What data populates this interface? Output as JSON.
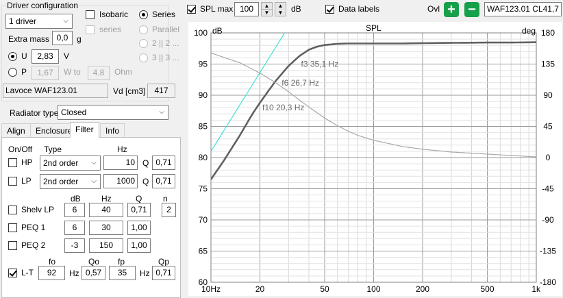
{
  "left": {
    "driver_config_title": "Driver configuration",
    "driver_count": "1 driver",
    "isobaric_label": "Isobaric",
    "series_option": "Series",
    "series_sub_label": "series",
    "parallel_option": "Parallel",
    "option_2_2": "2 || 2 ...",
    "option_3_3": "3 || 3 ...",
    "extra_mass_label": "Extra mass",
    "extra_mass_value": "0,0",
    "extra_mass_unit": "g",
    "u_label": "U",
    "u_value": "2,83",
    "u_unit": "V",
    "p_label": "P",
    "p_value": "1,67",
    "w_to_label": "W to",
    "ohm_value": "4,8",
    "ohm_unit": "Ohm",
    "driver_name": "Lavoce WAF123.01",
    "vd_label": "Vd [cm3]",
    "vd_value": "417",
    "radiator_label": "Radiator type",
    "radiator_value": "Closed",
    "tabs": [
      "Align",
      "Enclosure",
      "Filter",
      "Info"
    ],
    "filter": {
      "onoff_label": "On/Off",
      "type_label": "Type",
      "hz_label": "Hz",
      "hp_label": "HP",
      "hp_type": "2nd order",
      "hp_hz": "10",
      "hp_q_label": "Q",
      "hp_q": "0,71",
      "lp_label": "LP",
      "lp_type": "2nd order",
      "lp_hz": "1000",
      "lp_q_label": "Q",
      "lp_q": "0,71",
      "col_db": "dB",
      "col_hz": "Hz",
      "col_q": "Q",
      "col_n": "n",
      "shelv_label": "Shelv LP",
      "shelv_db": "6",
      "shelv_hz": "40",
      "shelv_q": "0,71",
      "shelv_n": "2",
      "peq1_label": "PEQ 1",
      "peq1_db": "6",
      "peq1_hz": "30",
      "peq1_q": "1,00",
      "peq2_label": "PEQ 2",
      "peq2_db": "-3",
      "peq2_hz": "150",
      "peq2_q": "1,00",
      "lt_col_fo": "fo",
      "lt_col_qo": "Qo",
      "lt_col_fp": "fp",
      "lt_col_qp": "Qp",
      "lt_label": "L-T",
      "lt_fo": "92",
      "lt_hz1": "Hz",
      "lt_qo": "0,57",
      "lt_fp": "35",
      "lt_hz2": "Hz",
      "lt_qp": "0,71"
    }
  },
  "toolbar": {
    "spl_max_label": "SPL max",
    "spl_max_value": "100",
    "db_label": "dB",
    "data_labels_label": "Data labels",
    "ovl_label": "Ovl",
    "ovl_value": "WAF123.01 CL41,7"
  },
  "colors": {
    "main_curve": "#606060",
    "phase_curve": "#a8a8a8",
    "excursion_line": "#40e0d8",
    "ovl_button": "#17a04a"
  },
  "chart_data": {
    "type": "line",
    "title": "SPL",
    "ylabel": "dB",
    "y2label": "deg",
    "x_scale": "log",
    "xlim": [
      10,
      1000
    ],
    "ylim": [
      60,
      100
    ],
    "y2lim": [
      -180,
      180
    ],
    "x_tick_labels": [
      "10Hz",
      "20",
      "50",
      "100",
      "200",
      "500",
      "1k"
    ],
    "x_ticks": [
      10,
      20,
      50,
      100,
      200,
      500,
      1000
    ],
    "y_ticks": [
      60,
      65,
      70,
      75,
      80,
      85,
      90,
      95,
      100
    ],
    "y2_ticks": [
      -180,
      -135,
      -90,
      -45,
      0,
      45,
      90,
      135,
      180
    ],
    "grid": true,
    "series": [
      {
        "role": "spl",
        "x": [
          10,
          12,
          15,
          18,
          20,
          25,
          30,
          35,
          40,
          45,
          50,
          60,
          70,
          80,
          100,
          150,
          200,
          300,
          500,
          700,
          1000
        ],
        "y": [
          76.5,
          79.5,
          83.5,
          87.0,
          88.8,
          92.3,
          94.7,
          96.3,
          97.3,
          97.8,
          98.05,
          98.25,
          98.3,
          98.3,
          98.3,
          98.3,
          98.35,
          98.4,
          98.45,
          98.45,
          98.5
        ]
      },
      {
        "role": "phase",
        "axis": "y2",
        "x": [
          10,
          15,
          20,
          25,
          30,
          35,
          40,
          50,
          60,
          70,
          80,
          100,
          150,
          200,
          300,
          500,
          700,
          1000
        ],
        "y": [
          151,
          137,
          122,
          108,
          95,
          83,
          73,
          57,
          46,
          38,
          32,
          25,
          16,
          12,
          8,
          5,
          3,
          1
        ]
      },
      {
        "role": "excursion",
        "x": [
          10,
          30
        ],
        "y": [
          81,
          101
        ]
      }
    ],
    "annotations": [
      {
        "text": "f3 35,1 Hz",
        "x": 35.1,
        "y": 95.0
      },
      {
        "text": "f6 26,7 Hz",
        "x": 26.7,
        "y": 92.0
      },
      {
        "text": "f10 20,3 Hz",
        "x": 20.3,
        "y": 88.0
      }
    ]
  }
}
